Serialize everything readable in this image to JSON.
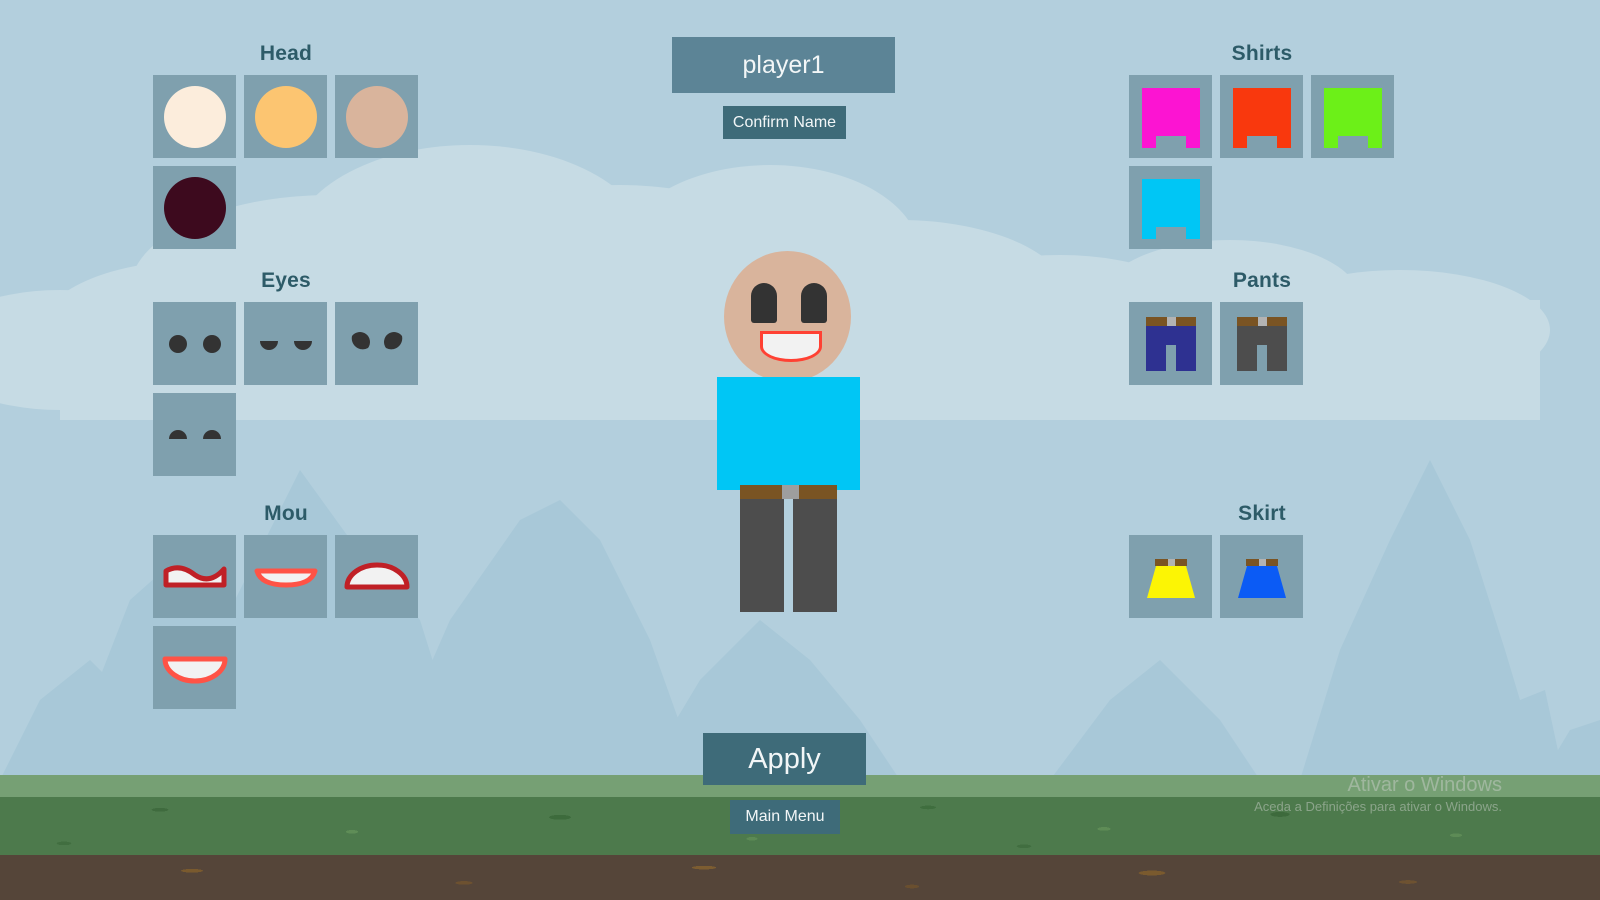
{
  "scene": {
    "sky_color": "#b3cfdd",
    "cloud_color": "#c6dbe4",
    "mountain_color": "#a8c8d8",
    "ground_light_color": "#76a074",
    "grass_color": "#4d7a4c",
    "dirt_color": "#554539"
  },
  "name_field": {
    "value": "player1",
    "placeholder": "player1"
  },
  "buttons": {
    "confirm_name": "Confirm Name",
    "apply": "Apply",
    "main_menu": "Main Menu"
  },
  "sections": {
    "head": {
      "title": "Head",
      "options": [
        {
          "name": "head-skin-pale",
          "color": "#fceddc"
        },
        {
          "name": "head-skin-tan",
          "color": "#fcc571"
        },
        {
          "name": "head-skin-brown",
          "color": "#d9b49c"
        },
        {
          "name": "head-skin-dark",
          "color": "#3d0a1e"
        }
      ]
    },
    "eyes": {
      "title": "Eyes",
      "options": [
        {
          "name": "eyes-round",
          "style": "round",
          "color": "#333333"
        },
        {
          "name": "eyes-sleepy",
          "style": "sleepy",
          "color": "#333333"
        },
        {
          "name": "eyes-angry",
          "style": "angry",
          "color": "#333333"
        },
        {
          "name": "eyes-halfmoon",
          "style": "halfmoon",
          "color": "#333333"
        }
      ]
    },
    "mouth": {
      "title": "Mou",
      "options": [
        {
          "name": "mouth-wavy",
          "style": "wavy",
          "outline": "#c02026",
          "fill": "#f2f2f2"
        },
        {
          "name": "mouth-flat",
          "style": "flat",
          "outline": "#ff5346",
          "fill": "#f2f2f2"
        },
        {
          "name": "mouth-arch-up",
          "style": "arch-up",
          "outline": "#c02026",
          "fill": "#f2f2f2"
        },
        {
          "name": "mouth-arch-down",
          "style": "arch-down",
          "outline": "#ff5346",
          "fill": "#f2f2f2"
        }
      ]
    },
    "shirts": {
      "title": "Shirts",
      "options": [
        {
          "name": "shirt-magenta",
          "color": "#fc14d2"
        },
        {
          "name": "shirt-red",
          "color": "#f9380d"
        },
        {
          "name": "shirt-green",
          "color": "#6cf018"
        },
        {
          "name": "shirt-cyan",
          "color": "#00c6f5"
        }
      ]
    },
    "pants": {
      "title": "Pants",
      "options": [
        {
          "name": "pants-navy",
          "color": "#2e3191",
          "belt": "#7a5423",
          "buckle": "#b3b3b3"
        },
        {
          "name": "pants-darkgray",
          "color": "#4d4d4d",
          "belt": "#7a5423",
          "buckle": "#b3b3b3"
        }
      ]
    },
    "skirt": {
      "title": "Skirt",
      "options": [
        {
          "name": "skirt-yellow",
          "color": "#fcf504",
          "belt": "#7a5423",
          "buckle": "#b3b3b3"
        },
        {
          "name": "skirt-blue",
          "color": "#0b5bf5",
          "belt": "#7a5423",
          "buckle": "#b3b3b3"
        }
      ]
    }
  },
  "avatar": {
    "skin_color": "#d9b49c",
    "eye_color": "#333333",
    "mouth_outline": "#ff4133",
    "mouth_fill": "#f2f2f2",
    "shirt_color": "#00c6f5",
    "pants_color": "#4d4d4d",
    "belt_color": "#7a5423",
    "buckle_color": "#9e9e9e"
  },
  "watermark": {
    "title": "Ativar o Windows",
    "subtitle": "Aceda a Definições para ativar o Windows."
  }
}
